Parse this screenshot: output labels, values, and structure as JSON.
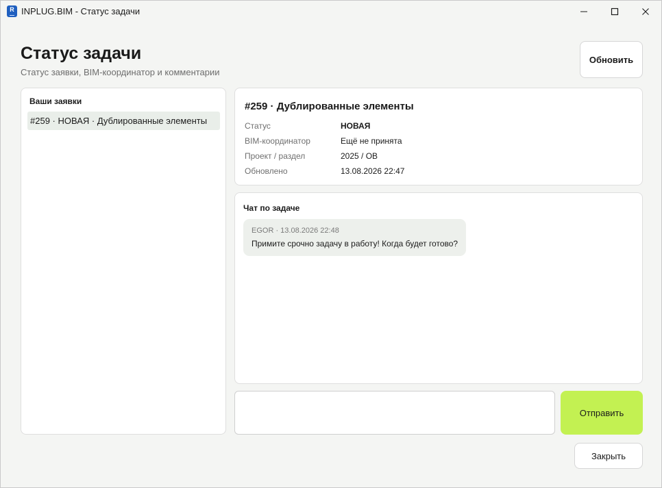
{
  "window": {
    "title": "INPLUG.BIM - Статус задачи",
    "app_icon_letter": "R"
  },
  "header": {
    "title": "Статус задачи",
    "subtitle": "Статус заявки, BIM-координатор и комментарии",
    "refresh_label": "Обновить"
  },
  "requests": {
    "heading": "Ваши заявки",
    "items": [
      {
        "label": "#259 · НОВАЯ · Дублированные элементы"
      }
    ]
  },
  "details": {
    "title": "#259 · Дублированные элементы",
    "rows": [
      {
        "label": "Статус",
        "value": "НОВАЯ"
      },
      {
        "label": "BIM-координатор",
        "value": "Ещё не принята"
      },
      {
        "label": "Проект / раздел",
        "value": "2025 / ОВ"
      },
      {
        "label": "Обновлено",
        "value": "13.08.2026 22:47"
      }
    ]
  },
  "chat": {
    "heading": "Чат по задаче",
    "messages": [
      {
        "meta": "EGOR · 13.08.2026 22:48",
        "text": "Примите срочно задачу в работу! Когда будет готово?"
      }
    ],
    "input_value": "",
    "send_label": "Отправить"
  },
  "footer": {
    "close_label": "Закрыть"
  },
  "colors": {
    "accent_send": "#c3f152",
    "background": "#f4f5f3",
    "selected_item": "#e9eee9",
    "app_icon": "#1f5fbf"
  },
  "icons": {
    "minimize": "minimize-icon",
    "maximize": "maximize-icon",
    "close": "close-icon"
  }
}
